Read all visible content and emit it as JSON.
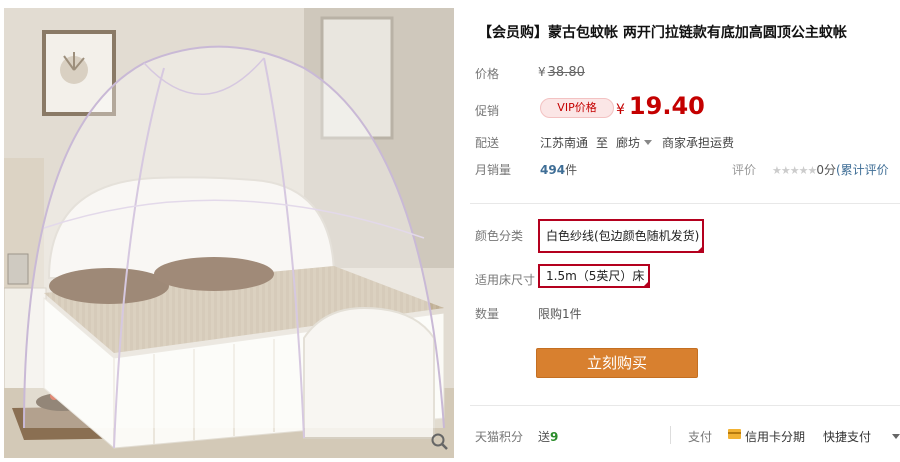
{
  "product": {
    "title": "【会员购】蒙古包蚊帐 两开门拉链款有底加高圆顶公主蚊帐"
  },
  "price": {
    "label": "价格",
    "currency": "¥",
    "original": "38.80"
  },
  "promo": {
    "label": "促销",
    "badge": "VIP价格",
    "currency": "¥",
    "value": "19.40"
  },
  "shipping": {
    "label": "配送",
    "from": "江苏南通",
    "to_word": "至",
    "to": "廊坊",
    "note": "商家承担运费"
  },
  "sales": {
    "label": "月销量",
    "count": "494",
    "unit": "件"
  },
  "rating": {
    "label": "评价",
    "stars": "★★★★★",
    "score": "0分",
    "link": "(累计评价"
  },
  "sku": {
    "color_label": "颜色分类",
    "color_value": "白色纱线(包边颜色随机发货)",
    "size_label": "适用床尺寸",
    "size_value": "1.5m（5英尺）床"
  },
  "quantity": {
    "label": "数量",
    "limit": "限购1件"
  },
  "buy_button": "立刻购买",
  "footer": {
    "points_label": "天猫积分",
    "points_prefix": "送",
    "points_value": "9",
    "pay_label": "支付",
    "card_pay": "信用卡分期",
    "quick_pay": "快捷支付"
  },
  "icons": {
    "zoom": "magnifier-icon",
    "card": "credit-card-icon",
    "dropdown": "chevron-down-icon"
  },
  "colors": {
    "accent_red": "#c40000",
    "buy_orange": "#d8802f",
    "sku_border": "#b4001e",
    "link_blue": "#3f6e96"
  }
}
